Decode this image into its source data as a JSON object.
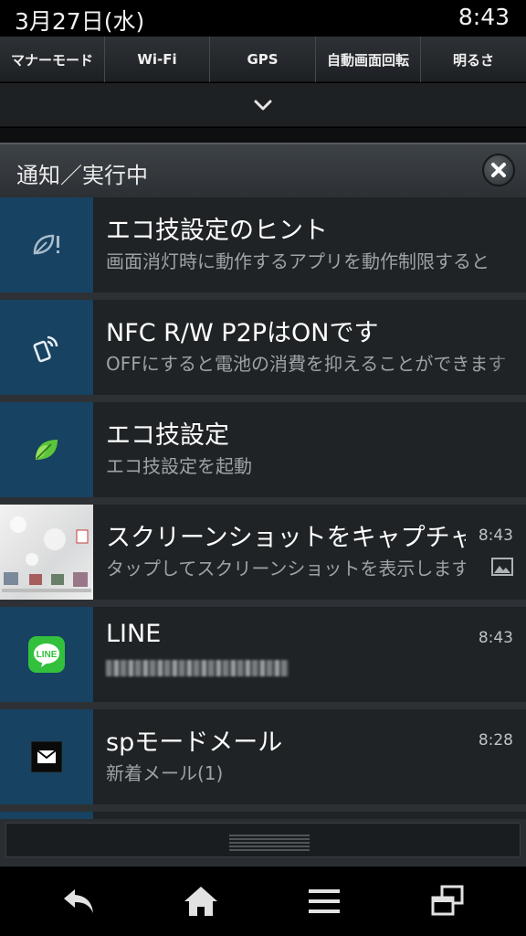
{
  "status_bar": {
    "date": "3月27日(水)",
    "time": "8:43"
  },
  "quick_settings": {
    "buttons": [
      {
        "label": "マナーモード"
      },
      {
        "label": "Wi-Fi"
      },
      {
        "label": "GPS"
      },
      {
        "label": "自動画面回転"
      },
      {
        "label": "明るさ"
      }
    ],
    "expander_icon": "chevron-down-icon"
  },
  "notifications_panel": {
    "header_title": "通知／実行中",
    "clear_icon": "close-icon",
    "items": [
      {
        "icon": "eco-leaf-hint-icon",
        "title": "エコ技設定のヒント",
        "text": "画面消灯時に動作するアプリを動作制限すると",
        "time": ""
      },
      {
        "icon": "nfc-phone-icon",
        "title": "NFC R/W P2PはONです",
        "text": "OFFにすると電池の消費を抑えることができます",
        "time": ""
      },
      {
        "icon": "eco-leaf-icon",
        "title": "エコ技設定",
        "text": "エコ技設定を起動",
        "time": ""
      },
      {
        "icon": "screenshot-thumbnail",
        "title": "スクリーンショットをキャプチャしました",
        "text": "タップしてスクリーンショットを表示します",
        "time": "8:43",
        "badge_icon": "image-icon"
      },
      {
        "icon": "line-app-icon",
        "title": "LINE",
        "text": "",
        "time": "8:43"
      },
      {
        "icon": "mail-icon",
        "title": "spモードメール",
        "text": "新着メール(1)",
        "time": "8:28"
      }
    ]
  },
  "nav_bar": {
    "icons": [
      "back-icon",
      "home-icon",
      "menu-icon",
      "recent-apps-icon"
    ]
  },
  "colors": {
    "accent_blue": "#174261",
    "item_bg": "#1f2326",
    "line_green": "#33c13d"
  }
}
